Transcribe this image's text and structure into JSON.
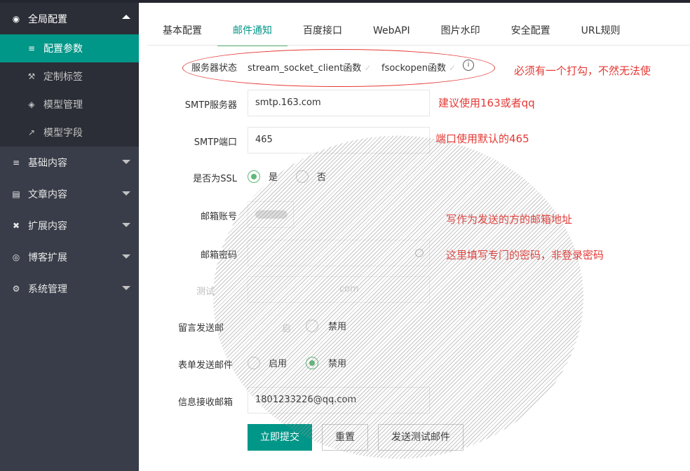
{
  "sidebar": {
    "groups": [
      {
        "label": "全局配置",
        "icon": "globe-icon"
      },
      {
        "label": "基础内容",
        "icon": "sliders-icon"
      },
      {
        "label": "文章内容",
        "icon": "document-icon"
      },
      {
        "label": "扩展内容",
        "icon": "expand-icon"
      },
      {
        "label": "博客扩展",
        "icon": "location-icon"
      },
      {
        "label": "系统管理",
        "icon": "gear-icon"
      }
    ],
    "sub_items": [
      {
        "label": "配置参数",
        "icon": "sliders-icon"
      },
      {
        "label": "定制标签",
        "icon": "wrench-icon"
      },
      {
        "label": "模型管理",
        "icon": "cube-icon"
      },
      {
        "label": "模型字段",
        "icon": "external-link-icon"
      }
    ]
  },
  "tabs": [
    "基本配置",
    "邮件通知",
    "百度接口",
    "WebAPI",
    "图片水印",
    "安全配置",
    "URL规则"
  ],
  "form": {
    "server_status": {
      "label": "服务器状态",
      "opt1": "stream_socket_client函数",
      "opt2": "fsockopen函数",
      "info_icon": "i"
    },
    "smtp_server": {
      "label": "SMTP服务器",
      "value": "smtp.163.com"
    },
    "smtp_port": {
      "label": "SMTP端口",
      "value": "465"
    },
    "ssl": {
      "label": "是否为SSL",
      "yes": "是",
      "no": "否"
    },
    "account": {
      "label": "邮箱账号"
    },
    "password": {
      "label": "邮箱密码"
    },
    "test": {
      "label": "测试",
      "value_suffix": "com"
    },
    "comment_mail": {
      "label": "留言发送邮",
      "disabled": "禁用",
      "enabled_partial": "启"
    },
    "form_mail": {
      "label": "表单发送邮件",
      "enabled": "启用",
      "disabled": "禁用"
    },
    "receive_mail": {
      "label": "信息接收邮箱",
      "value": "1801233226@qq.com"
    }
  },
  "buttons": {
    "submit": "立即提交",
    "reset": "重置",
    "send_test": "发送测试邮件"
  },
  "notes": {
    "n1": "必须有一个打勾，不然无法使",
    "n2": "建议使用163或者qq",
    "n3": "端口使用默认的465",
    "n4": "写作为发送的方的邮箱地址",
    "n5": "这里填写专门的密码，非登录密码"
  },
  "colors": {
    "accent": "#009688",
    "radio_on": "#5fb878",
    "note_red": "#e53935",
    "sidebar_bg": "#393d49"
  }
}
